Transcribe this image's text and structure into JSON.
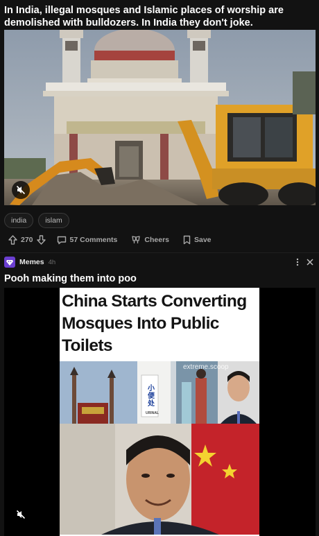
{
  "post1": {
    "title": "In India, illegal mosques and Islamic places of worship are demolished with bulldozers. In India they don't joke.",
    "tags": [
      "india",
      "islam"
    ],
    "upvotes": "270",
    "comments": "57 Comments",
    "cheers": "Cheers",
    "save": "Save"
  },
  "post2": {
    "community": "Memes",
    "age": "4h",
    "title": "Pooh making them into poo",
    "meme_headline": "China Starts Converting Mosques Into Public Toilets",
    "watermark": "extreme.scoop",
    "sign_text": "小便处",
    "sign_caption": "URINAL"
  },
  "icons": {
    "mute": "speaker-muted-icon",
    "upvote": "arrow-up-icon",
    "downvote": "arrow-down-icon",
    "comment": "comment-bubble-icon",
    "cheers": "cheers-icon",
    "save": "bookmark-icon",
    "more": "more-vertical-icon",
    "close": "close-icon"
  },
  "colors": {
    "background": "#121212",
    "community_avatar": "#6b3fd0",
    "muted_text": "#a8a8a8"
  }
}
